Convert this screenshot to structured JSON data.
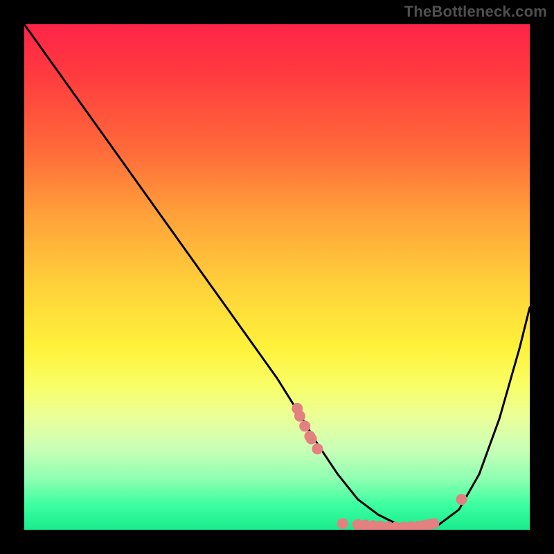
{
  "watermark": "TheBottleneck.com",
  "chart_data": {
    "type": "line",
    "title": "",
    "xlabel": "",
    "ylabel": "",
    "xlim": [
      0,
      100
    ],
    "ylim": [
      0,
      100
    ],
    "curve": {
      "x": [
        0,
        5,
        10,
        15,
        20,
        25,
        30,
        35,
        40,
        45,
        50,
        55,
        58,
        62,
        66,
        70,
        74,
        78,
        82,
        86,
        90,
        94,
        98,
        100
      ],
      "y": [
        100,
        93,
        86,
        79,
        72,
        65,
        58,
        51,
        44,
        37,
        30,
        22,
        17,
        11,
        6,
        3,
        1,
        0.5,
        1,
        4,
        11,
        22,
        36,
        44
      ]
    },
    "points": {
      "x": [
        54,
        54.5,
        55.5,
        56.5,
        56.8,
        58,
        63,
        66,
        67.5,
        69,
        70.5,
        72,
        73.5,
        75,
        76.5,
        78,
        79,
        80,
        81,
        86.5
      ],
      "y": [
        24,
        22.5,
        20.5,
        18.5,
        18,
        16,
        1.2,
        1,
        0.9,
        0.8,
        0.7,
        0.6,
        0.5,
        0.5,
        0.6,
        0.7,
        0.8,
        1.0,
        1.2,
        6
      ]
    },
    "colors": {
      "curve": "#000000",
      "points": "#e38080"
    }
  }
}
